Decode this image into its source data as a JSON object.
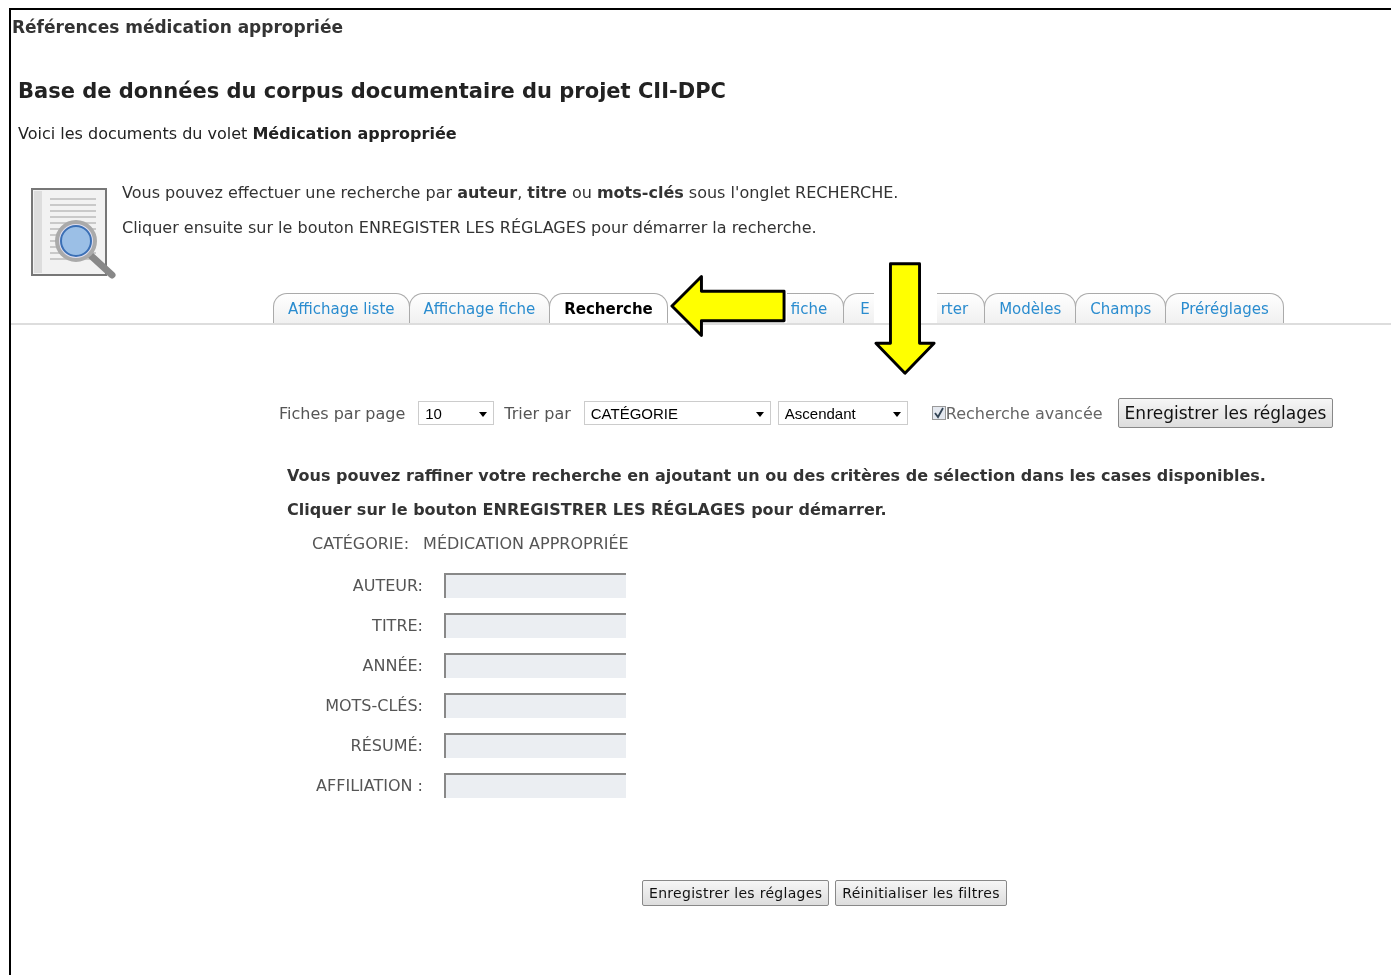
{
  "page_title": "Références médication appropriée",
  "heading": "Base de données du corpus documentaire du projet CII-DPC",
  "intro": "Voici les documents du volet **Médication appropriée**",
  "help_lines": [
    "Vous pouvez effectuer une recherche par **auteur**, **titre** ou **mots-clés** sous l'onglet RECHERCHE.",
    "Cliquer ensuite sur le bouton ENREGISTER LES RÉGLAGES pour démarrer la recherche."
  ],
  "tabs": [
    {
      "kind": "plain",
      "label": "Affichage liste",
      "selected": false
    },
    {
      "kind": "plain",
      "label": "Affichage fiche",
      "selected": false
    },
    {
      "kind": "plain",
      "label": "Recherche",
      "selected": true
    },
    {
      "kind": "covered_left",
      "label": "fiche",
      "selected": false
    },
    {
      "kind": "split",
      "label_start": "E",
      "label_end": "rter",
      "selected": false
    },
    {
      "kind": "plain",
      "label": "Modèles",
      "selected": false
    },
    {
      "kind": "plain",
      "label": "Champs",
      "selected": false
    },
    {
      "kind": "plain",
      "label": "Préréglages",
      "selected": false
    }
  ],
  "settings": {
    "per_page_label": "Fiches par page",
    "per_page": "10",
    "sort_label": "Trier par",
    "sort_field": "CATÉGORIE",
    "sort_order": "Ascendant",
    "advanced_label": "Recherche avancée",
    "advanced_checked": true,
    "save_button": "Enregistrer les réglages"
  },
  "refine_lines": [
    "Vous pouvez raffiner votre recherche en ajoutant un ou des critères de sélection dans les cases disponibles.",
    "Cliquer sur le bouton ENREGISTRER LES RÉGLAGES pour démarrer."
  ],
  "category": {
    "label": "CATÉGORIE:",
    "value": "MÉDICATION APPROPRIÉE"
  },
  "fields": [
    {
      "label": "AUTEUR:"
    },
    {
      "label": "TITRE:"
    },
    {
      "label": "ANNÉE:"
    },
    {
      "label": "MOTS-CLÉS:"
    },
    {
      "label": "RÉSUMÉ:"
    },
    {
      "label": "AFFILIATION :"
    }
  ],
  "buttons": [
    "Enregistrer les réglages",
    "Réinitialiser les filtres"
  ]
}
